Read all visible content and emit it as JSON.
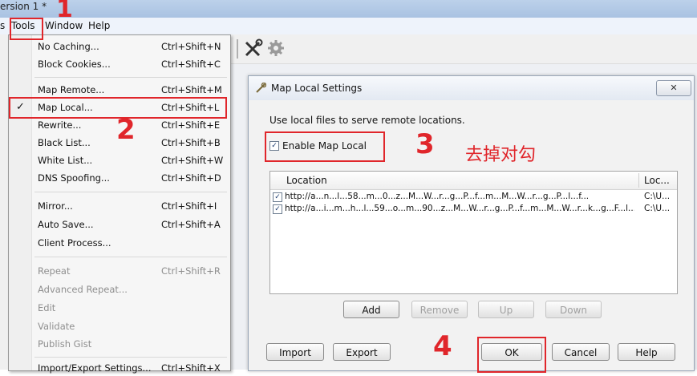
{
  "window": {
    "title": "ersion 1 *"
  },
  "menubar": {
    "partial_left": "s",
    "tools": "Tools",
    "window": "Window",
    "help": "Help"
  },
  "tools_menu": {
    "items": [
      {
        "label": "No Caching...",
        "shortcut": "Ctrl+Shift+N"
      },
      {
        "label": "Block Cookies...",
        "shortcut": "Ctrl+Shift+C"
      },
      {
        "label": "Map Remote...",
        "shortcut": "Ctrl+Shift+M"
      },
      {
        "label": "Map Local...",
        "shortcut": "Ctrl+Shift+L",
        "checked": true
      },
      {
        "label": "Rewrite...",
        "shortcut": "Ctrl+Shift+E"
      },
      {
        "label": "Black List...",
        "shortcut": "Ctrl+Shift+B"
      },
      {
        "label": "White List...",
        "shortcut": "Ctrl+Shift+W"
      },
      {
        "label": "DNS Spoofing...",
        "shortcut": "Ctrl+Shift+D"
      },
      {
        "label": "Mirror...",
        "shortcut": "Ctrl+Shift+I"
      },
      {
        "label": "Auto Save...",
        "shortcut": "Ctrl+Shift+A"
      },
      {
        "label": "Client Process...",
        "shortcut": ""
      },
      {
        "label": "Repeat",
        "shortcut": "Ctrl+Shift+R",
        "disabled": true
      },
      {
        "label": "Advanced Repeat...",
        "shortcut": "",
        "disabled": true
      },
      {
        "label": "Edit",
        "shortcut": "",
        "disabled": true
      },
      {
        "label": "Validate",
        "shortcut": "",
        "disabled": true
      },
      {
        "label": "Publish Gist",
        "shortcut": "",
        "disabled": true
      },
      {
        "label": "Import/Export Settings...",
        "shortcut": "Ctrl+Shift+X"
      }
    ],
    "check_glyph": "✓"
  },
  "toolbar": {
    "icons": [
      "tools-icon",
      "gear-icon"
    ]
  },
  "dialog": {
    "title": "Map Local Settings",
    "close_glyph": "✕",
    "description": "Use local files to serve remote locations.",
    "enable_label": "Enable Map Local",
    "enable_checked": true,
    "table": {
      "columns": [
        "Location",
        "Loc..."
      ],
      "rows": [
        {
          "checked": true,
          "location": "http://a...n...l...58...m...0...z...M...W...r...g...P...f...m...M...W...r...g...P...l...f...",
          "local": "C:\\U..."
        },
        {
          "checked": true,
          "location": "http://a...i...m...h...l...59...o...m...90...z...M...W...r...g...P...f...m...M...W...r...k...g...F...l...f...",
          "local": "C:\\U..."
        }
      ]
    },
    "buttons": {
      "add": "Add",
      "remove": "Remove",
      "up": "Up",
      "down": "Down",
      "import": "Import",
      "export": "Export",
      "ok": "OK",
      "cancel": "Cancel",
      "help": "Help"
    }
  },
  "annotations": {
    "step1": "1",
    "step2": "2",
    "step3": "3",
    "step4": "4",
    "note": "去掉对勾",
    "color": "#e0262b"
  }
}
